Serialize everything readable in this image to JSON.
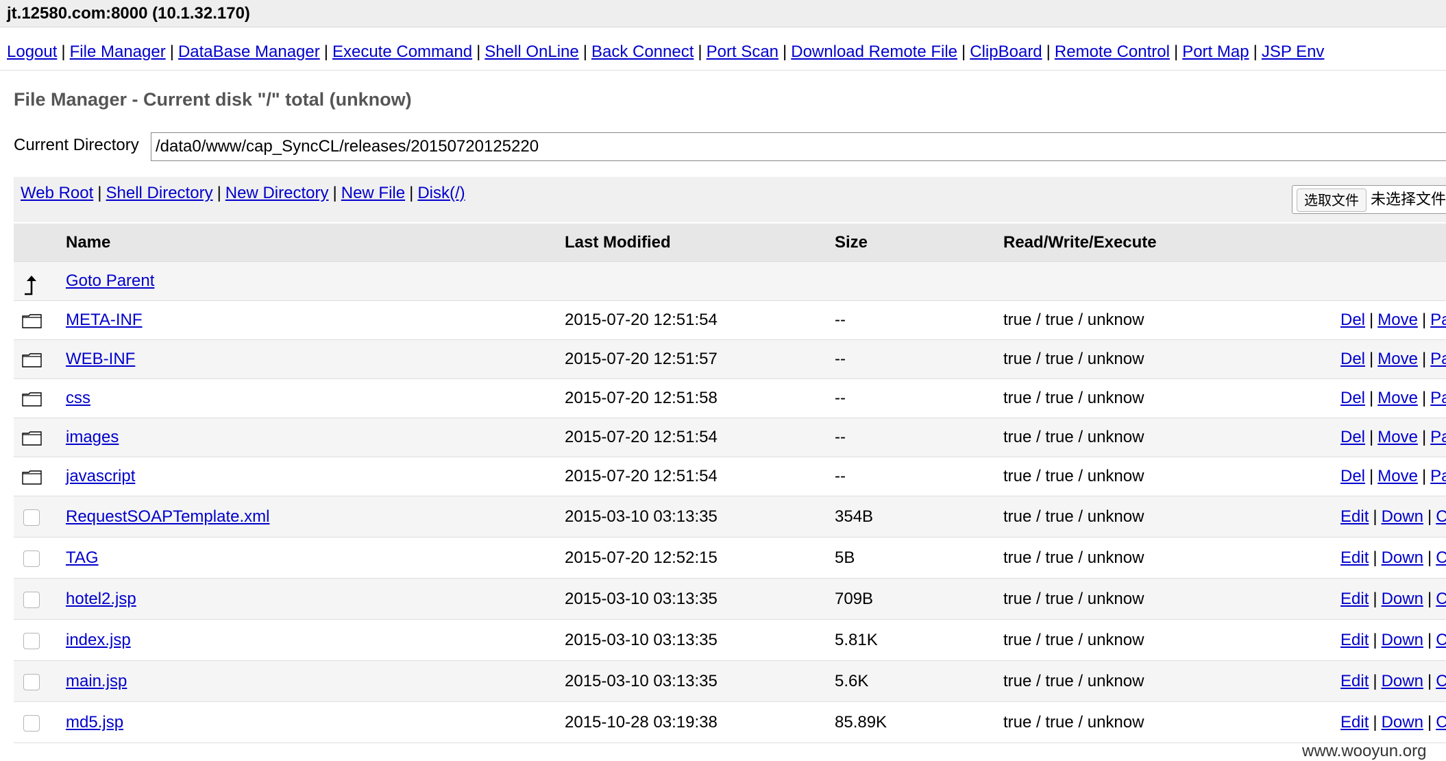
{
  "window": {
    "title": "jt.12580.com:8000 (10.1.32.170)"
  },
  "nav": [
    "Logout",
    "File Manager",
    "DataBase Manager",
    "Execute Command",
    "Shell OnLine",
    "Back Connect",
    "Port Scan",
    "Download Remote File",
    "ClipBoard",
    "Remote Control",
    "Port Map",
    "JSP Env"
  ],
  "page": {
    "title": "File Manager - Current disk \"/\" total (unknow)",
    "cwd_label": "Current Directory",
    "cwd_value": "/data0/www/cap_SyncCL/releases/20150720125220"
  },
  "toolbar": {
    "links": [
      "Web Root",
      "Shell Directory",
      "New Directory",
      "New File",
      "Disk(/)"
    ],
    "file_button": "选取文件",
    "file_status": "未选择文件"
  },
  "table": {
    "headers": {
      "name": "Name",
      "modified": "Last Modified",
      "size": "Size",
      "rwx": "Read/Write/Execute"
    },
    "parent": "Goto Parent",
    "rows": [
      {
        "type": "dir",
        "name": "META-INF",
        "modified": "2015-07-20 12:51:54",
        "size": "--",
        "rwx": "true / true / unknow",
        "actions": [
          "Del",
          "Move",
          "Pa"
        ]
      },
      {
        "type": "dir",
        "name": "WEB-INF",
        "modified": "2015-07-20 12:51:57",
        "size": "--",
        "rwx": "true / true / unknow",
        "actions": [
          "Del",
          "Move",
          "Pa"
        ]
      },
      {
        "type": "dir",
        "name": "css",
        "modified": "2015-07-20 12:51:58",
        "size": "--",
        "rwx": "true / true / unknow",
        "actions": [
          "Del",
          "Move",
          "Pa"
        ]
      },
      {
        "type": "dir",
        "name": "images",
        "modified": "2015-07-20 12:51:54",
        "size": "--",
        "rwx": "true / true / unknow",
        "actions": [
          "Del",
          "Move",
          "Pa"
        ]
      },
      {
        "type": "dir",
        "name": "javascript",
        "modified": "2015-07-20 12:51:54",
        "size": "--",
        "rwx": "true / true / unknow",
        "actions": [
          "Del",
          "Move",
          "Pa"
        ]
      },
      {
        "type": "file",
        "name": "RequestSOAPTemplate.xml",
        "modified": "2015-03-10 03:13:35",
        "size": "354B",
        "rwx": "true / true / unknow",
        "actions": [
          "Edit",
          "Down",
          "C"
        ]
      },
      {
        "type": "file",
        "name": "TAG",
        "modified": "2015-07-20 12:52:15",
        "size": "5B",
        "rwx": "true / true / unknow",
        "actions": [
          "Edit",
          "Down",
          "C"
        ]
      },
      {
        "type": "file",
        "name": "hotel2.jsp",
        "modified": "2015-03-10 03:13:35",
        "size": "709B",
        "rwx": "true / true / unknow",
        "actions": [
          "Edit",
          "Down",
          "C"
        ]
      },
      {
        "type": "file",
        "name": "index.jsp",
        "modified": "2015-03-10 03:13:35",
        "size": "5.81K",
        "rwx": "true / true / unknow",
        "actions": [
          "Edit",
          "Down",
          "C"
        ]
      },
      {
        "type": "file",
        "name": "main.jsp",
        "modified": "2015-03-10 03:13:35",
        "size": "5.6K",
        "rwx": "true / true / unknow",
        "actions": [
          "Edit",
          "Down",
          "C"
        ]
      },
      {
        "type": "file",
        "name": "md5.jsp",
        "modified": "2015-10-28 03:19:38",
        "size": "85.89K",
        "rwx": "true / true / unknow",
        "actions": [
          "Edit",
          "Down",
          "C"
        ]
      }
    ]
  },
  "watermark": "www.wooyun.org",
  "icons": {
    "dir": "folder-icon",
    "parent": "up-arrow-icon",
    "file": "checkbox"
  }
}
